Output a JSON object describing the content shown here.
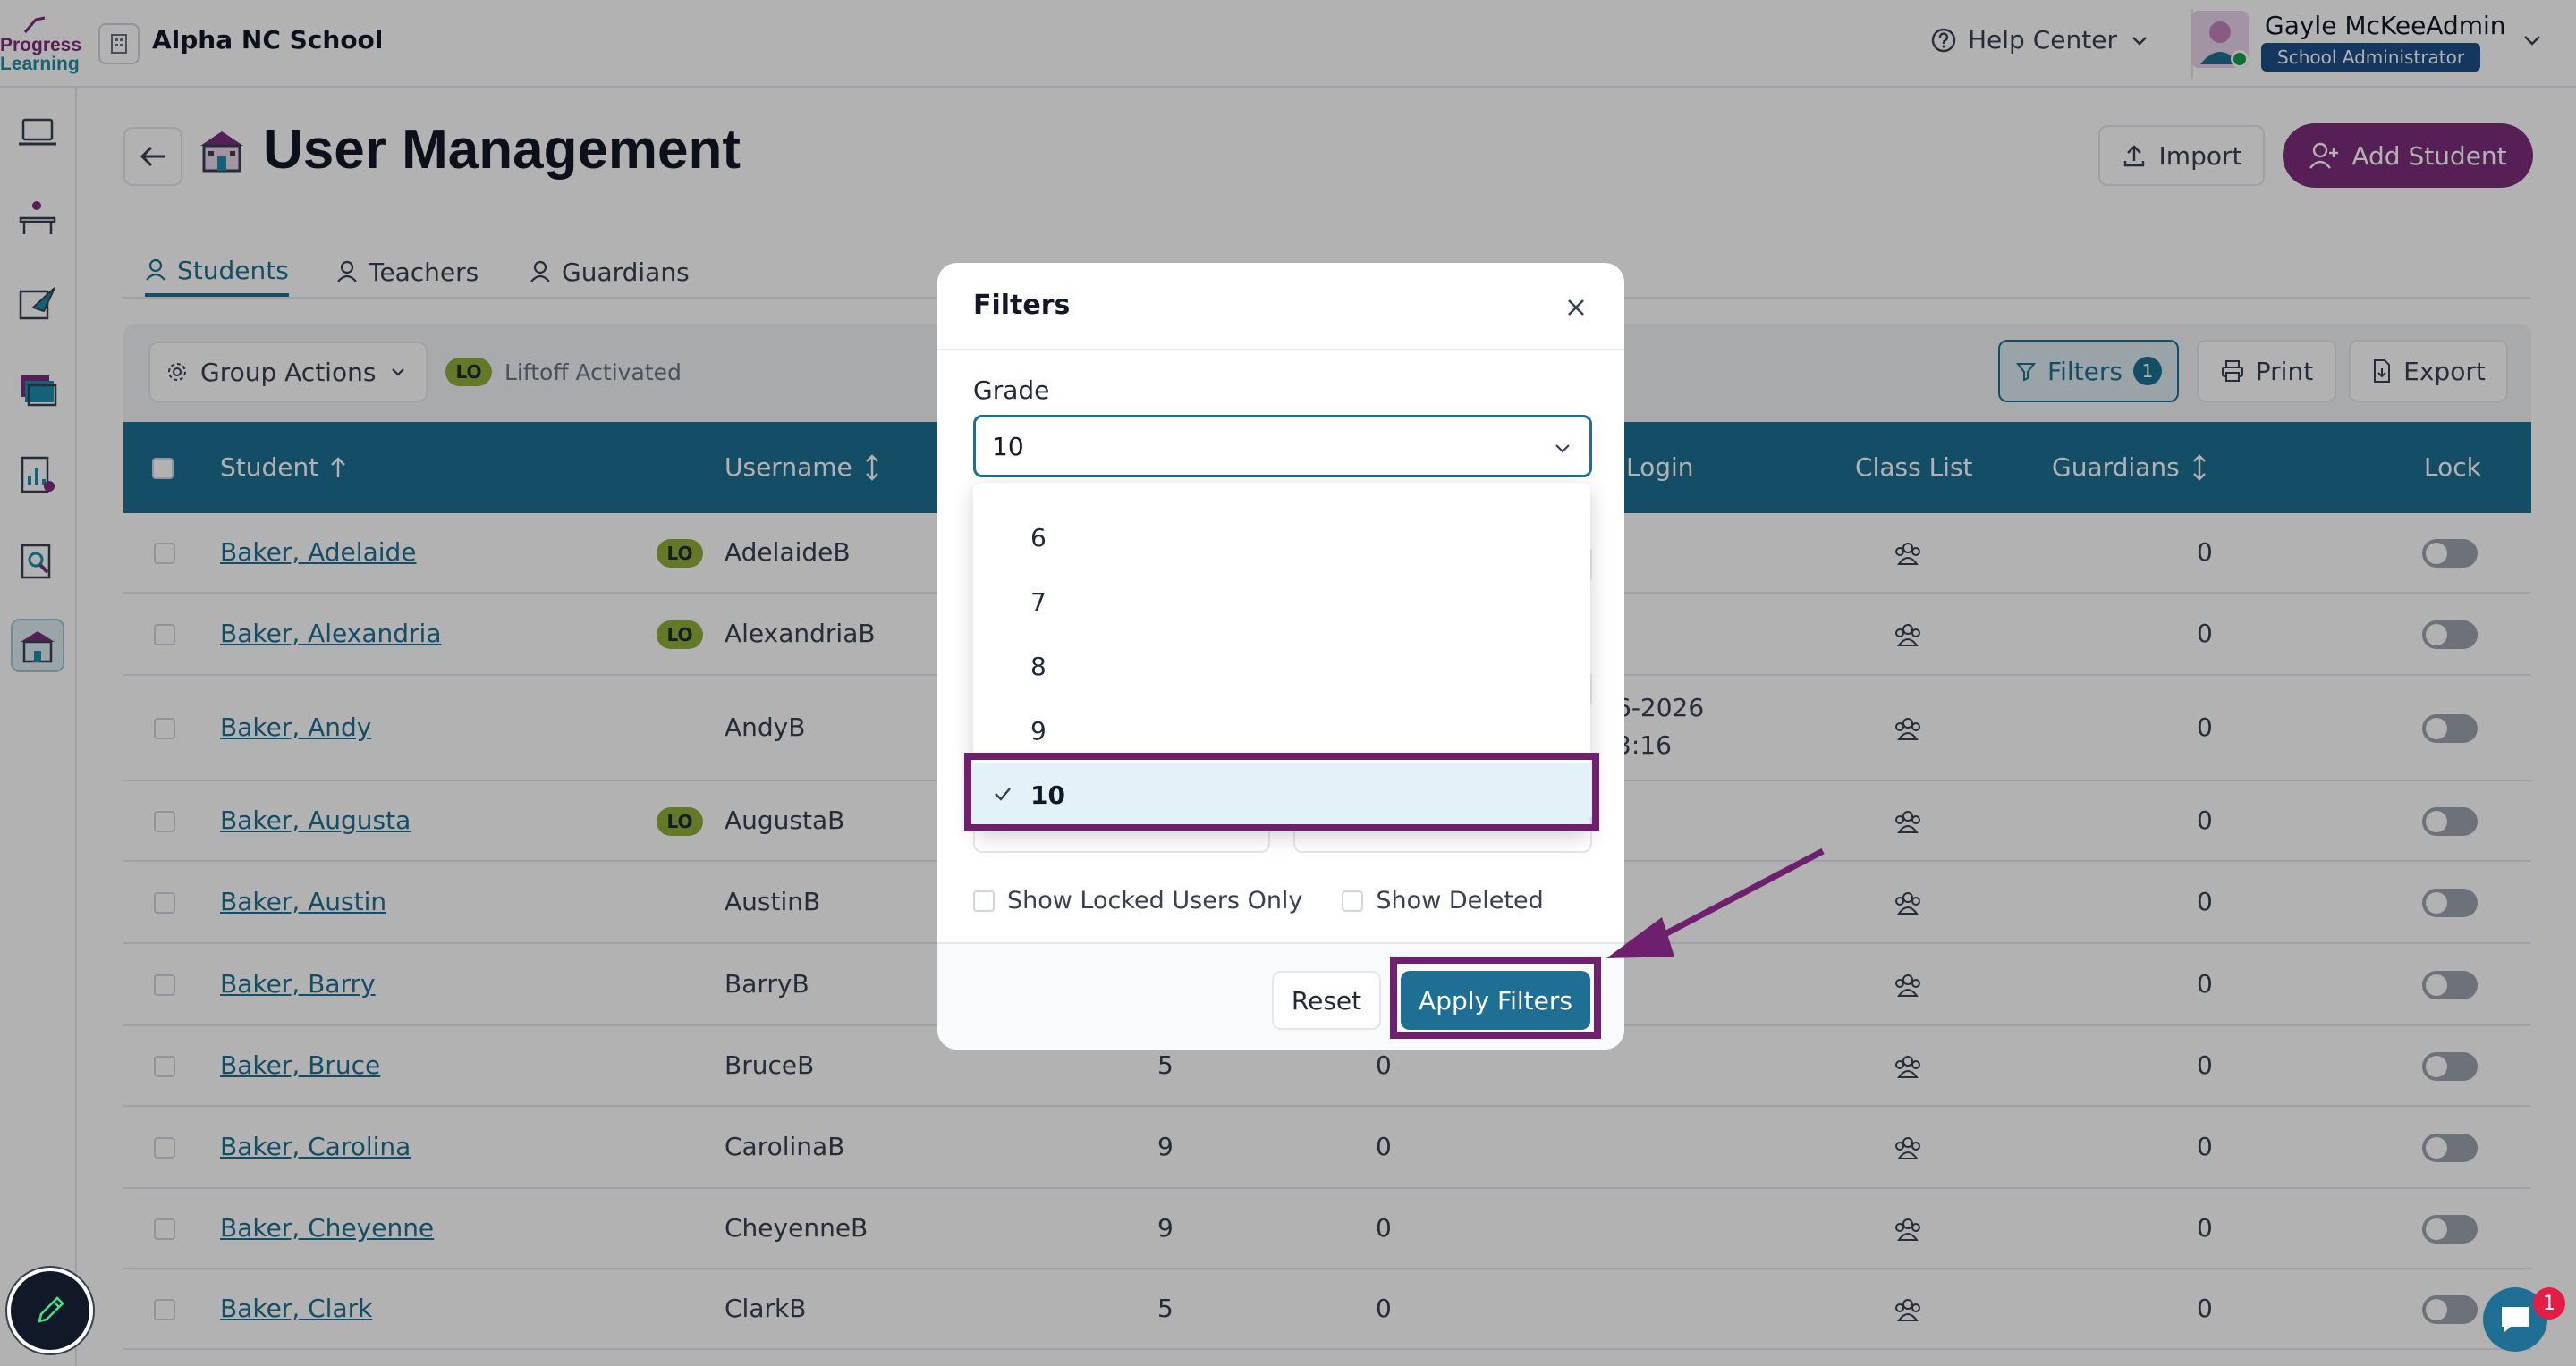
{
  "topbar": {
    "logo_line1": "Progress",
    "logo_line2": "Learning",
    "school_name": "Alpha NC School",
    "help_label": "Help Center",
    "user_name": "Gayle McKeeAdmin",
    "user_role": "School Administrator"
  },
  "sidebar": {
    "items": [
      "laptop-icon",
      "desk-icon",
      "assignment-icon",
      "folders-icon",
      "reports-icon",
      "analytics-icon",
      "school-icon"
    ],
    "active_item": "school-icon"
  },
  "page": {
    "title": "User Management",
    "import_label": "Import",
    "add_label": "Add Student"
  },
  "tabs": [
    {
      "label": "Students",
      "active": true
    },
    {
      "label": "Teachers",
      "active": false
    },
    {
      "label": "Guardians",
      "active": false
    }
  ],
  "toolbar": {
    "group_actions_label": "Group Actions",
    "lo_badge": "LO",
    "liftoff_label": "Liftoff Activated",
    "filters_label": "Filters",
    "filters_count": "1",
    "print_label": "Print",
    "export_label": "Export"
  },
  "table": {
    "headers": {
      "student": "Student",
      "username": "Username",
      "login": "Login",
      "class_list": "Class List",
      "guardians": "Guardians",
      "lock": "Lock"
    },
    "rows": [
      {
        "name": "Baker, Adelaide",
        "lo": "LO",
        "username": "AdelaideB",
        "grade": "",
        "col5": "",
        "login1": "",
        "login2": "",
        "guardians": "0"
      },
      {
        "name": "Baker, Alexandria",
        "lo": "LO",
        "username": "AlexandriaB",
        "grade": "",
        "col5": "",
        "login1": "",
        "login2": "",
        "guardians": "0"
      },
      {
        "name": "Baker, Andy",
        "lo": "",
        "username": "AndyB",
        "grade": "",
        "col5": "",
        "login1": "6-2026",
        "login2": "3:16",
        "guardians": "0"
      },
      {
        "name": "Baker, Augusta",
        "lo": "LO",
        "username": "AugustaB",
        "grade": "",
        "col5": "",
        "login1": "",
        "login2": "",
        "guardians": "0"
      },
      {
        "name": "Baker, Austin",
        "lo": "",
        "username": "AustinB",
        "grade": "",
        "col5": "",
        "login1": "",
        "login2": "",
        "guardians": "0"
      },
      {
        "name": "Baker, Barry",
        "lo": "",
        "username": "BarryB",
        "grade": "",
        "col5": "",
        "login1": "",
        "login2": "",
        "guardians": "0"
      },
      {
        "name": "Baker, Bruce",
        "lo": "",
        "username": "BruceB",
        "grade": "5",
        "col5": "0",
        "login1": "",
        "login2": "",
        "guardians": "0"
      },
      {
        "name": "Baker, Carolina",
        "lo": "",
        "username": "CarolinaB",
        "grade": "9",
        "col5": "0",
        "login1": "",
        "login2": "",
        "guardians": "0"
      },
      {
        "name": "Baker, Cheyenne",
        "lo": "",
        "username": "CheyenneB",
        "grade": "9",
        "col5": "0",
        "login1": "",
        "login2": "",
        "guardians": "0"
      },
      {
        "name": "Baker, Clark",
        "lo": "",
        "username": "ClarkB",
        "grade": "5",
        "col5": "0",
        "login1": "",
        "login2": "",
        "guardians": "0"
      }
    ]
  },
  "modal": {
    "title": "Filters",
    "grade_label": "Grade",
    "grade_value": "10",
    "options": [
      {
        "label": "6",
        "selected": false
      },
      {
        "label": "7",
        "selected": false
      },
      {
        "label": "8",
        "selected": false
      },
      {
        "label": "9",
        "selected": false
      },
      {
        "label": "10",
        "selected": true
      }
    ],
    "show_locked_label": "Show Locked Users Only",
    "show_deleted_label": "Show Deleted",
    "reset_label": "Reset",
    "apply_label": "Apply Filters"
  },
  "chat": {
    "badge": "1"
  },
  "colors": {
    "primary": "#1e6f93",
    "brand_purple": "#7b2d7b",
    "annotation": "#6e1f6e",
    "lo_badge": "#8fae3a"
  }
}
